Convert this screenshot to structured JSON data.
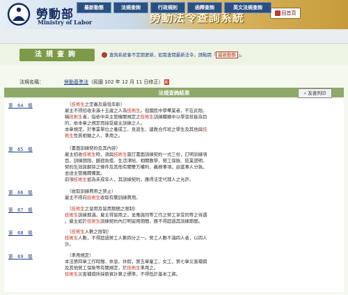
{
  "header": {
    "ministry_cn": "勞動部",
    "ministry_en": "Ministry of Labor",
    "system_title": "勞動法令查詢系統",
    "home_label": "回首頁"
  },
  "nav": {
    "tabs": [
      "最新動態",
      "法規查詢",
      "行政規則",
      "函釋查詢",
      "英文法規查詢"
    ]
  },
  "section": {
    "title": "法規查詢",
    "notice_prefix": "查詢系統會不定期更新，如需查閱最新法令，請點閱「",
    "notice_link": "最新動態",
    "notice_suffix": "」。"
  },
  "law": {
    "label": "法規名稱：",
    "name": "勞動基準法",
    "amended": "（民國 102 年 12 月 11 日修正）",
    "badge": "新"
  },
  "results": {
    "title": "法規查詢結果",
    "print_label": "友善列印",
    "articles": [
      {
        "id": "第　64　條",
        "lines": [
          [
            [
              "",
              "　（"
            ],
            [
              "k",
              "技術生"
            ],
            [
              "",
              "之定義及最低年齡）"
            ]
          ],
          [
            [
              "",
              "雇主不得招收未滿十五歲之人為"
            ],
            [
              "k",
              "技術生"
            ],
            [
              "",
              "。但國民中學畢業者，不在此限。"
            ]
          ],
          [
            [
              "",
              "稱"
            ],
            [
              "k",
              "技術生"
            ],
            [
              "",
              "者，指依中央主管機關規定之"
            ],
            [
              "k",
              "技術生"
            ],
            [
              "",
              "訓練職類中以學習技能為目"
            ]
          ],
          [
            [
              "",
              "的，依本章之規定而接受雇主訓練之人。"
            ]
          ],
          [
            [
              "",
              "本章規定，於事業單位之養成工、見習生、建教合作班之學生及其他與"
            ],
            [
              "k",
              "技"
            ]
          ],
          [
            [
              "k",
              "術生"
            ],
            [
              "",
              "性質相類之人，準用之。"
            ]
          ]
        ]
      },
      {
        "id": "第　65　條",
        "lines": [
          [
            [
              "",
              "　（書面訓練契約及其內容）"
            ]
          ],
          [
            [
              "",
              "雇主招收"
            ],
            [
              "k",
              "技術生"
            ],
            [
              "",
              "時，須與"
            ],
            [
              "k",
              "技術生"
            ],
            [
              "",
              "簽訂書面訓練契約一式三份，訂明訓練項"
            ]
          ],
          [
            [
              "",
              "目、訓練期限、膳宿負擔、生活津貼、相關教學、勞工保險、結業證明、"
            ]
          ],
          [
            [
              "",
              "契約生效與解除之條件及其他有關雙方權利、義務事項，由當事人分執，"
            ]
          ],
          [
            [
              "",
              "並送主管機關備案。"
            ]
          ],
          [
            [
              "",
              "前項"
            ],
            [
              "k",
              "技術生"
            ],
            [
              "",
              "如為未成年人，其訓練契約，應得法定代理人之允許。"
            ]
          ]
        ]
      },
      {
        "id": "第　66　條",
        "lines": [
          [
            [
              "",
              "　（收取訓練費用之禁止）"
            ]
          ],
          [
            [
              "",
              "雇主不得向"
            ],
            [
              "k",
              "技術生"
            ],
            [
              "",
              "收取有關訓練費用。"
            ]
          ]
        ]
      },
      {
        "id": "第　67　條",
        "lines": [
          [
            [
              "",
              "　（"
            ],
            [
              "k",
              "技術生"
            ],
            [
              "",
              "之留用及留用期間之限制）"
            ]
          ],
          [
            [
              "k",
              "技術生"
            ],
            [
              "",
              "訓練期滿，雇主得留用之，並應與同等工作之勞工享受同等之待遇"
            ]
          ],
          [
            [
              "",
              "。雇主如於"
            ],
            [
              "k",
              "技術生"
            ],
            [
              "",
              "訓練契約內訂明留用期間，應不得超過其訓練期間。"
            ]
          ]
        ]
      },
      {
        "id": "第　68　條",
        "lines": [
          [
            [
              "",
              "　（"
            ],
            [
              "k",
              "技術生"
            ],
            [
              "",
              "人數之限制）"
            ]
          ],
          [
            [
              "k",
              "技術生"
            ],
            [
              "",
              "人數，不得超過勞工人數四分之一。勞工人數不滿四人者，以四人"
            ]
          ],
          [
            [
              "",
              "計。"
            ]
          ]
        ]
      },
      {
        "id": "第　69　條",
        "lines": [
          [
            [
              "",
              "　（準用規定）"
            ]
          ],
          [
            [
              "",
              "本法第四章工作時間、休息、休假，第五章童工、女工，第七章災害補償"
            ]
          ],
          [
            [
              "",
              "及其他勞工保險等有關規定，於"
            ],
            [
              "k",
              "技術生"
            ],
            [
              "",
              "準用之。"
            ]
          ],
          [
            [
              "k",
              "技術生"
            ],
            [
              "",
              "災害補償所採薪資計算之標準，不得低於基本工資。"
            ]
          ]
        ]
      }
    ]
  },
  "colors": {
    "accent_green": "#8ea96a",
    "nav_blue": "#2a4f80",
    "keyword_red": "#c0392b",
    "link_blue": "#1d3f8a"
  }
}
